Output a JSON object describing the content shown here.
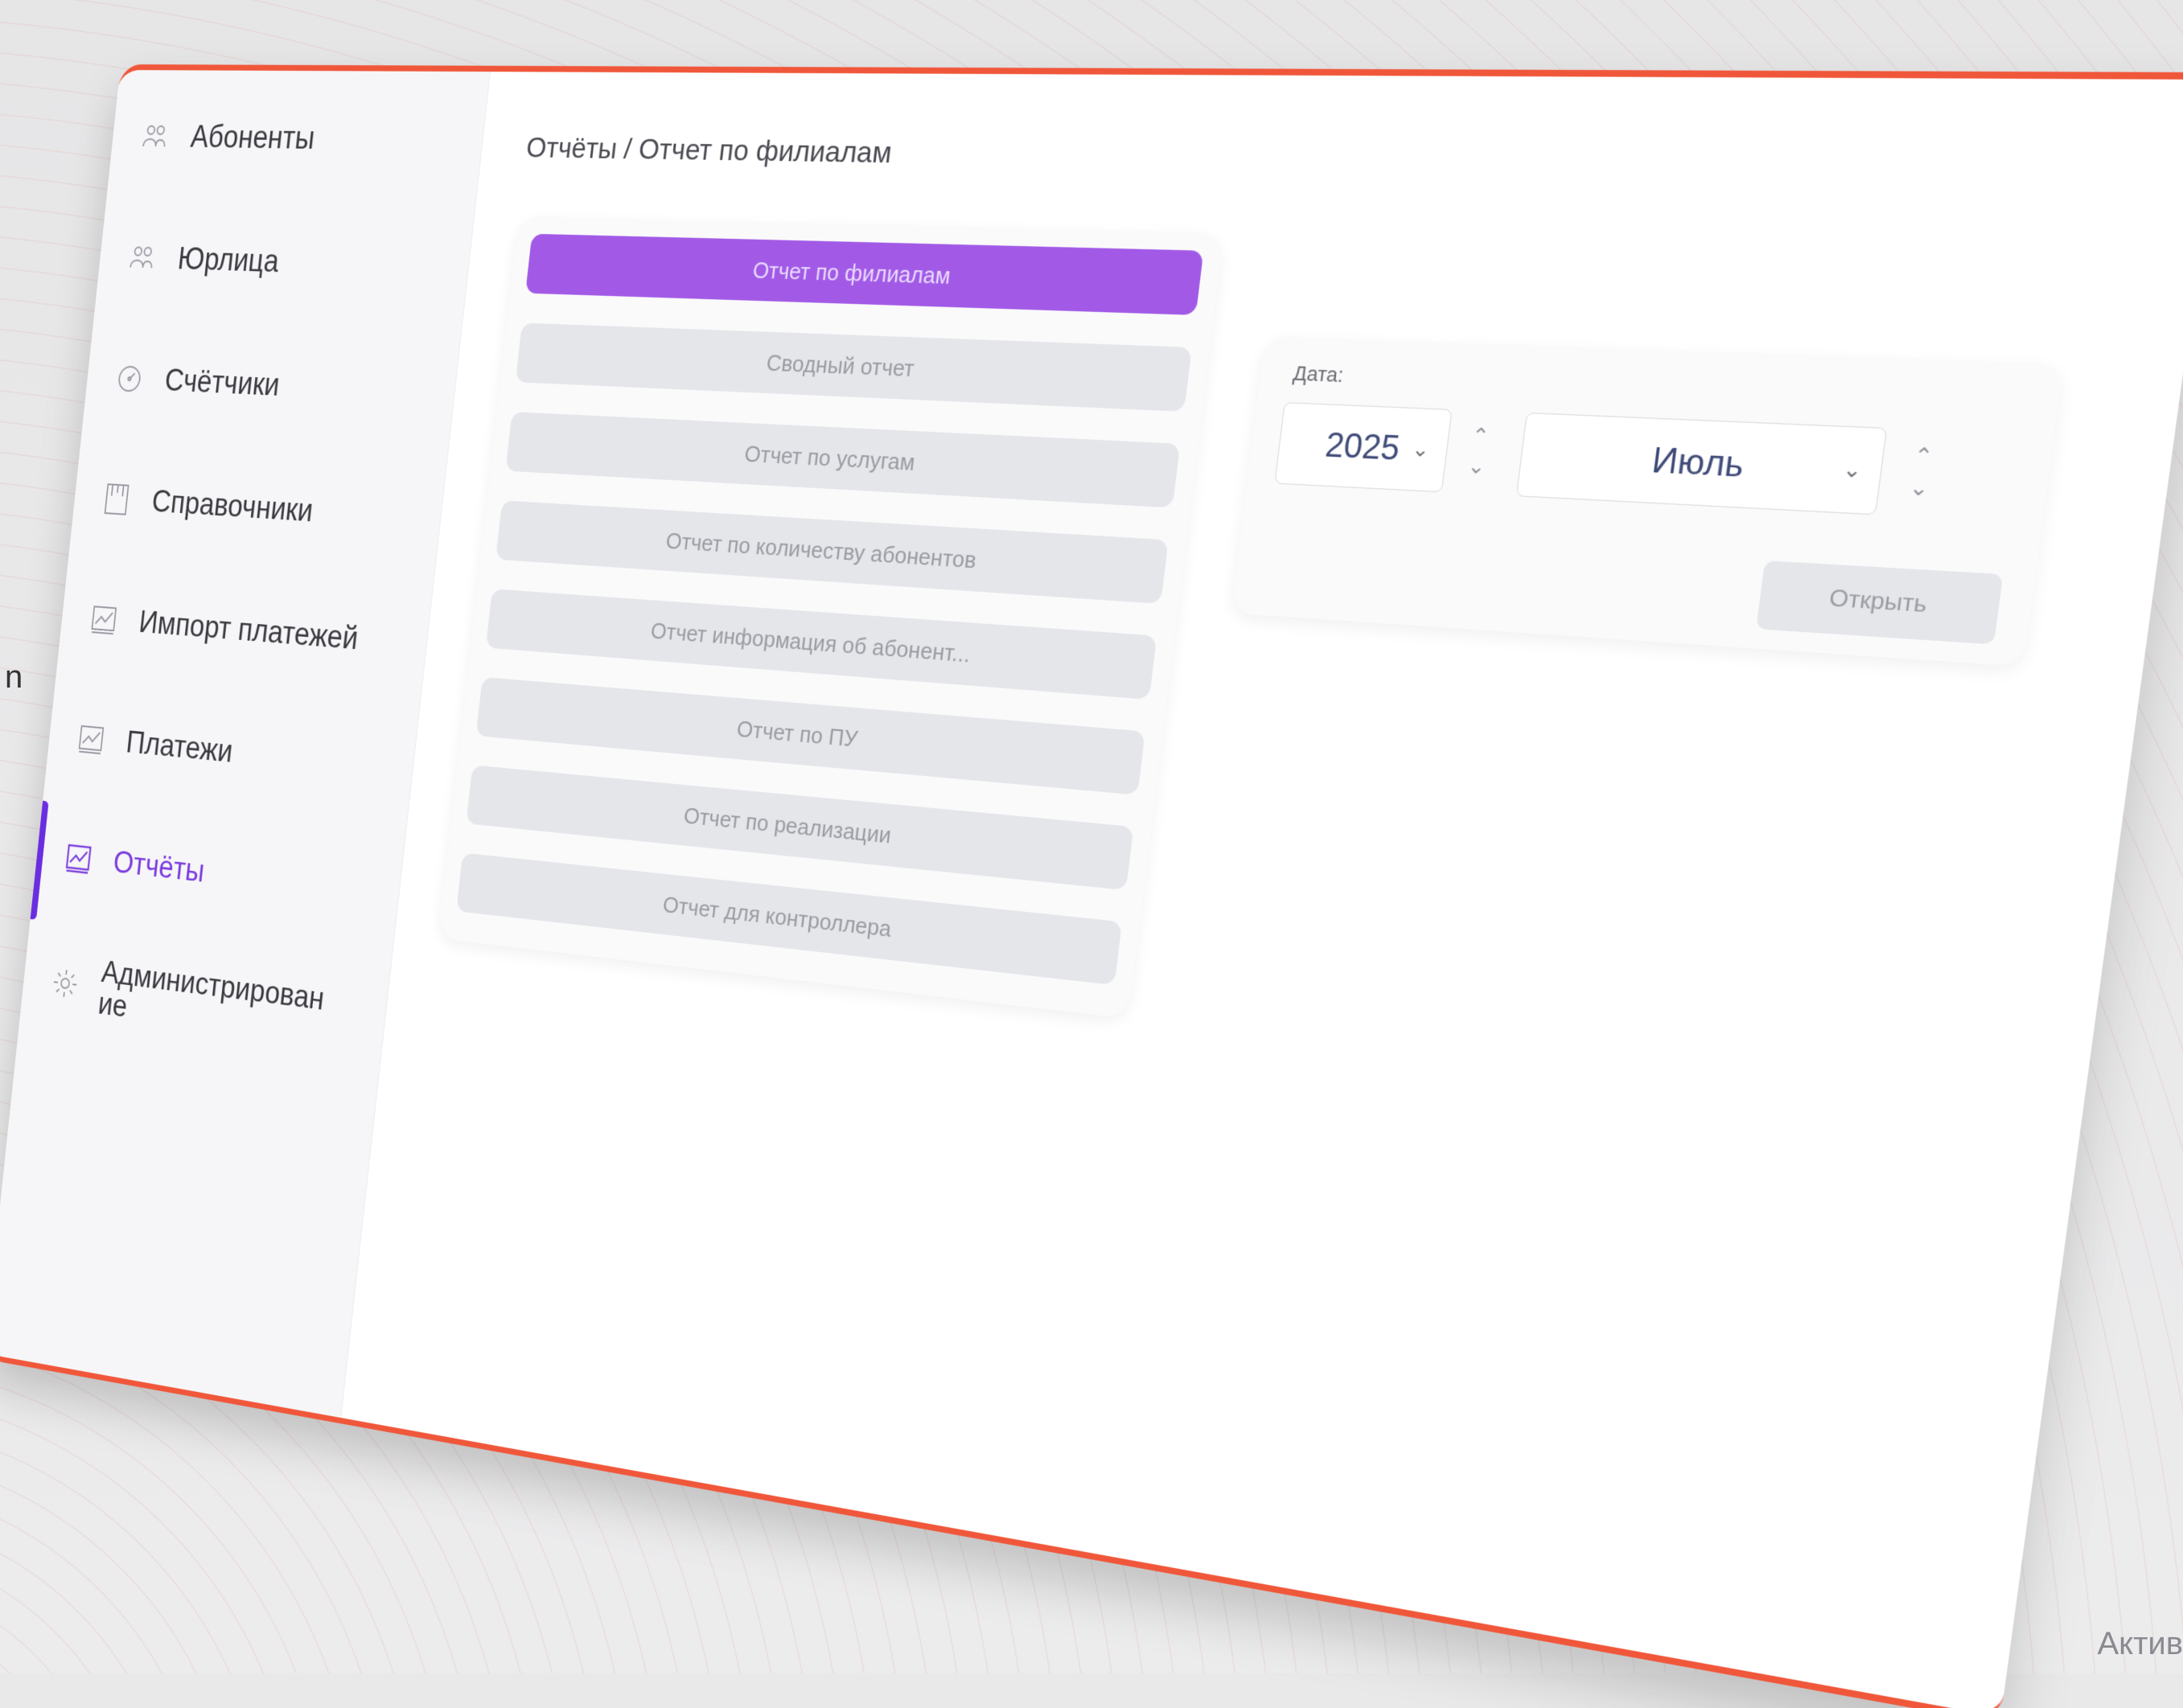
{
  "breadcrumb": "Отчёты / Отчет по филиалам",
  "sidebar": {
    "items": [
      {
        "label": "Абоненты",
        "icon": "users-icon",
        "active": false
      },
      {
        "label": "Юрлица",
        "icon": "users-icon",
        "active": false
      },
      {
        "label": "Счётчики",
        "icon": "gauge-icon",
        "active": false
      },
      {
        "label": "Справочники",
        "icon": "book-icon",
        "active": false
      },
      {
        "label": "Импорт платежей",
        "icon": "chart-icon",
        "active": false
      },
      {
        "label": "Платежи",
        "icon": "chart-icon",
        "active": false
      },
      {
        "label": "Отчёты",
        "icon": "chart-icon",
        "active": true
      },
      {
        "label": "Администрирован\nие",
        "icon": "gear-icon",
        "active": false
      }
    ]
  },
  "reports": {
    "items": [
      {
        "label": "Отчет по филиалам",
        "selected": true
      },
      {
        "label": "Сводный отчет",
        "selected": false
      },
      {
        "label": "Отчет по услугам",
        "selected": false
      },
      {
        "label": "Отчет по количеству абонентов",
        "selected": false
      },
      {
        "label": "Отчет информация об абонент...",
        "selected": false
      },
      {
        "label": "Отчет по ПУ",
        "selected": false
      },
      {
        "label": "Отчет по реализации",
        "selected": false
      },
      {
        "label": "Отчет для контроллера",
        "selected": false
      }
    ]
  },
  "date_form": {
    "label": "Дата:",
    "year": "2025",
    "month": "Июль",
    "open_label": "Открыть"
  },
  "corner_text": "Актив",
  "left_fragment": "n",
  "colors": {
    "accent": "#7b3cdf",
    "selected_report": "#a25ae6",
    "frame_border": "#f0573a"
  }
}
